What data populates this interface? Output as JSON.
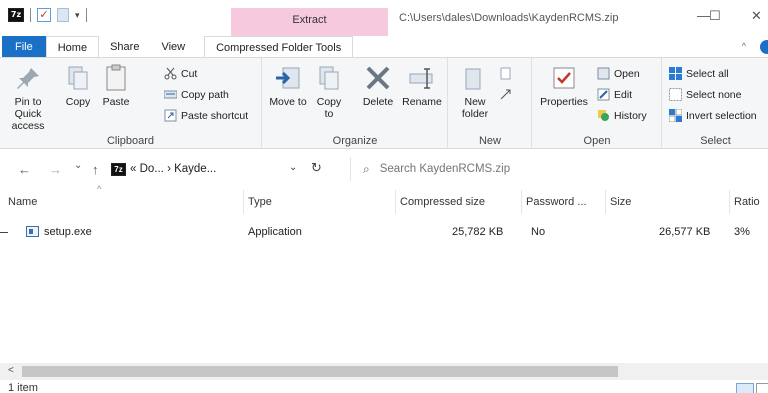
{
  "titlebar": {
    "extract_tab": "Extract",
    "path": "C:\\Users\\dales\\Downloads\\KaydenRCMS.zip",
    "minimize": "—",
    "maximize": "☐",
    "close": "✕"
  },
  "qat": {
    "app_badge": "7z",
    "dropdown": "▾"
  },
  "tabs": [
    "File",
    "Home",
    "Share",
    "View",
    "Compressed Folder Tools"
  ],
  "ribbon": {
    "clipboard": {
      "label": "Clipboard",
      "pin": "Pin to Quick access",
      "copy": "Copy",
      "paste": "Paste",
      "cut": "Cut",
      "copy_path": "Copy path",
      "paste_shortcut": "Paste shortcut"
    },
    "organize": {
      "label": "Organize",
      "move_to": "Move to",
      "copy_to": "Copy to",
      "delete": "Delete",
      "rename": "Rename"
    },
    "new": {
      "label": "New",
      "new_folder": "New folder"
    },
    "open": {
      "label": "Open",
      "properties": "Properties",
      "open": "Open",
      "edit": "Edit",
      "history": "History"
    },
    "select": {
      "label": "Select",
      "select_all": "Select all",
      "select_none": "Select none",
      "invert": "Invert selection"
    }
  },
  "nav": {
    "back": "←",
    "forward": "→",
    "recent": "⌄",
    "up": "↑",
    "crumbs": "« Do... › Kayde...",
    "search_placeholder": "Search KaydenRCMS.zip"
  },
  "columns": [
    "Name",
    "Type",
    "Compressed size",
    "Password ...",
    "Size",
    "Ratio"
  ],
  "files": [
    {
      "name": "setup.exe",
      "type": "Application",
      "compressed_size": "25,782 KB",
      "password": "No",
      "size": "26,577 KB",
      "ratio": "3%"
    }
  ],
  "status": {
    "item_count": "1 item"
  },
  "colors": {
    "accent": "#1a6fc6",
    "extract_tab": "#f6c9de",
    "ribbon_bg": "#f5f6f7"
  }
}
